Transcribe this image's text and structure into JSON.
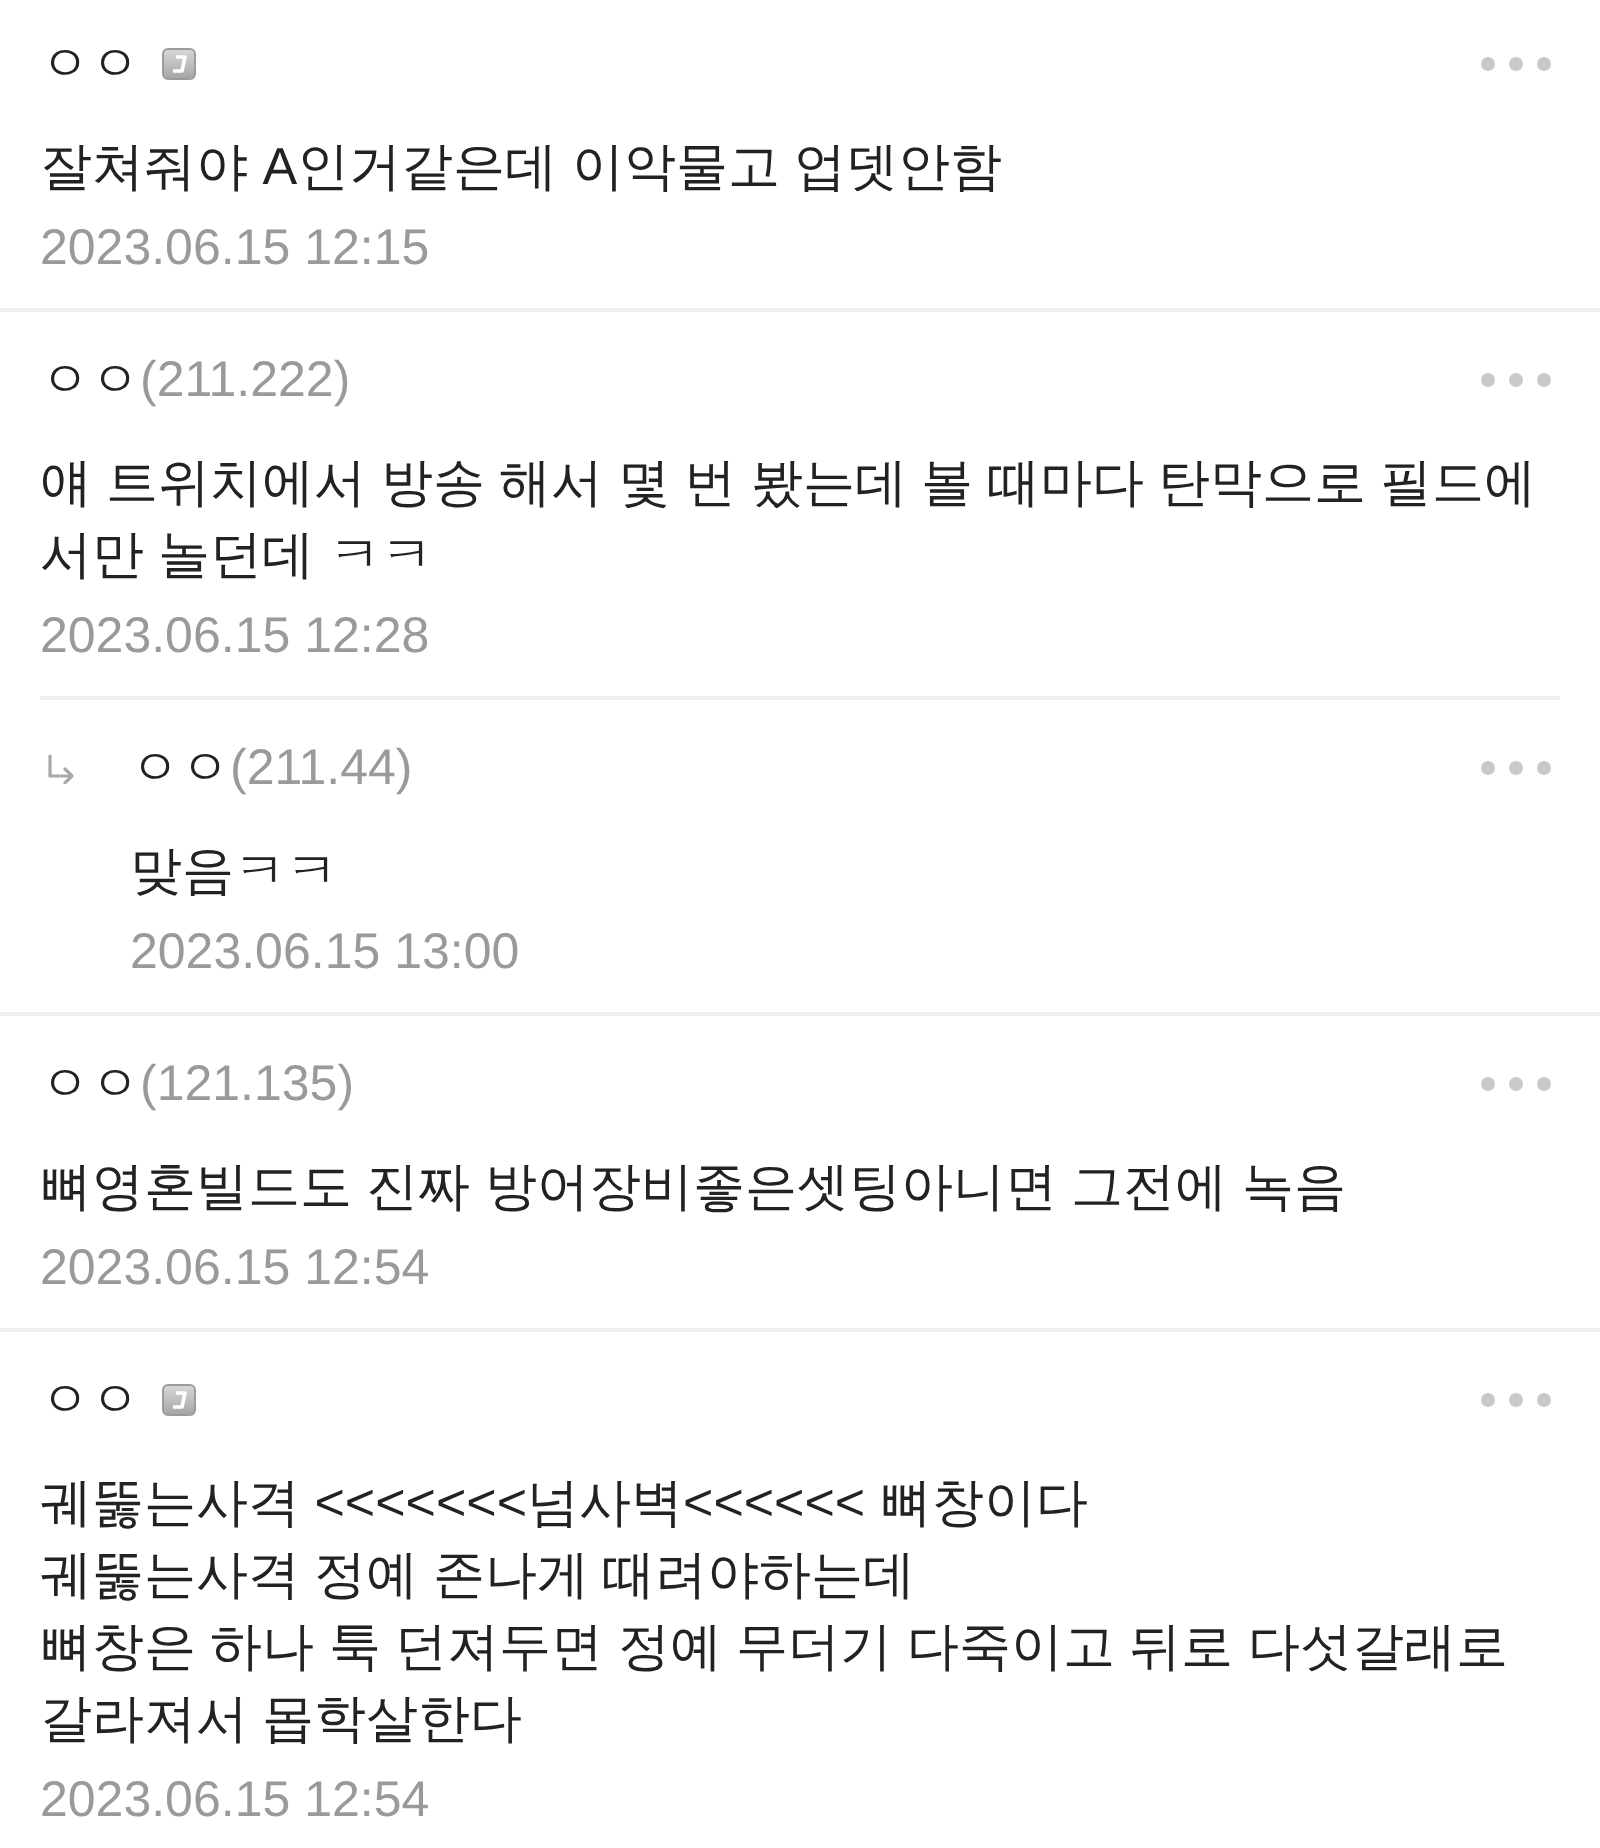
{
  "comments": [
    {
      "kind": "comment",
      "author": "ㅇㅇ",
      "badge": true,
      "body": "잘쳐줘야 A인거같은데 이악물고 업뎃안함",
      "date": "2023.06.15 12:15"
    },
    {
      "kind": "comment",
      "author": "ㅇㅇ",
      "ip": "(211.222)",
      "badge": false,
      "body": "얘 트위치에서 방송 해서 몇 번 봤는데 볼 때마다 탄막으로 필드에서만 놀던데 ㅋㅋ",
      "date": "2023.06.15 12:28"
    },
    {
      "kind": "reply",
      "author": "ㅇㅇ",
      "ip": "(211.44)",
      "badge": false,
      "body": "맞음ㅋㅋ",
      "date": "2023.06.15 13:00"
    },
    {
      "kind": "comment",
      "author": "ㅇㅇ",
      "ip": "(121.135)",
      "badge": false,
      "body": "뼈영혼빌드도 진짜 방어장비좋은셋팅아니면 그전에 녹음",
      "date": "2023.06.15 12:54"
    },
    {
      "kind": "comment",
      "author": "ㅇㅇ",
      "badge": true,
      "body": "궤뚫는사격 <<<<<<<넘사벽<<<<<< 뼈창이다\n궤뚫는사격 정예 존나게 때려야하는데\n뼈창은 하나 툭 던져두면 정예 무더기 다죽이고 뒤로 다섯갈래로 갈라져서 몹학살한다",
      "date": "2023.06.15 12:54"
    }
  ]
}
